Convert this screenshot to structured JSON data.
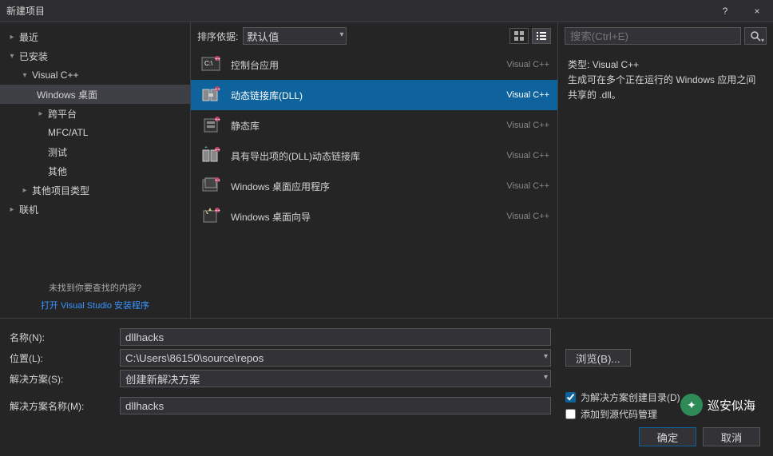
{
  "title": "新建项目",
  "titlebar": {
    "help": "?",
    "close": "×"
  },
  "nav": {
    "recent": "最近",
    "installed": "已安装",
    "visualcpp": "Visual C++",
    "windows_desktop": "Windows 桌面",
    "cross_platform": "跨平台",
    "mfc_atl": "MFC/ATL",
    "test": "测试",
    "other": "其他",
    "other_proj_types": "其他项目类型",
    "online": "联机",
    "hint": "未找到你要查找的内容?",
    "link": "打开 Visual Studio 安装程序"
  },
  "center": {
    "sort_label": "排序依据:",
    "sort_value": "默认值"
  },
  "templates": [
    {
      "name": "控制台应用",
      "lang": "Visual C++"
    },
    {
      "name": "动态链接库(DLL)",
      "lang": "Visual C++"
    },
    {
      "name": "静态库",
      "lang": "Visual C++"
    },
    {
      "name": "具有导出项的(DLL)动态链接库",
      "lang": "Visual C++"
    },
    {
      "name": "Windows 桌面应用程序",
      "lang": "Visual C++"
    },
    {
      "name": "Windows 桌面向导",
      "lang": "Visual C++"
    }
  ],
  "right": {
    "search_placeholder": "搜索(Ctrl+E)",
    "type_label": "类型:",
    "type_value": "Visual C++",
    "description": "生成可在多个正在运行的 Windows 应用之间共享的 .dll。"
  },
  "form": {
    "name_label": "名称(N):",
    "name_value": "dllhacks",
    "location_label": "位置(L):",
    "location_value": "C:\\Users\\86150\\source\\repos",
    "solution_label": "解决方案(S):",
    "solution_value": "创建新解决方案",
    "solution_name_label": "解决方案名称(M):",
    "solution_name_value": "dllhacks",
    "browse": "浏览(B)...",
    "checkbox1": "为解决方案创建目录(D)",
    "checkbox2": "添加到源代码管理"
  },
  "buttons": {
    "ok": "确定",
    "cancel": "取消"
  },
  "watermark": "巡安似海"
}
